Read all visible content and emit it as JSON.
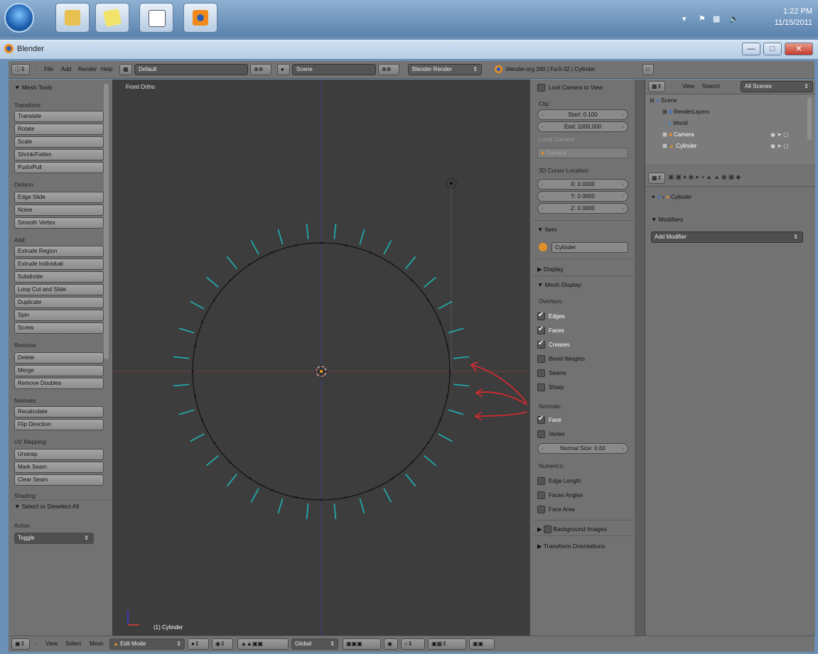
{
  "taskbar": {
    "time": "1:22 PM",
    "date": "11/15/2011",
    "buttons": [
      "start-orb",
      "file-explorer-icon",
      "sticky-notes-icon",
      "calendar-app-icon",
      "blender-app-icon"
    ]
  },
  "window": {
    "title": "Blender"
  },
  "header": {
    "menus": [
      "File",
      "Add",
      "Render",
      "Help"
    ],
    "screen_layout": "Default",
    "scene": "Scene",
    "render_engine": "Blender Render",
    "info": "blender.org 260 | Fa:0-32 | Cylinder"
  },
  "tool_shelf": {
    "title": "Mesh Tools",
    "transform_label": "Transform:",
    "transform": [
      "Translate",
      "Rotate",
      "Scale",
      "Shrink/Fatten",
      "Push/Pull"
    ],
    "deform_label": "Deform:",
    "deform": [
      "Edge Slide",
      "Noise",
      "Smooth Vertex"
    ],
    "add_label": "Add:",
    "add": [
      "Extrude Region",
      "Extrude Individual",
      "Subdivide",
      "Loop Cut and Slide",
      "Duplicate",
      "Spin",
      "Screw"
    ],
    "remove_label": "Remove:",
    "remove": [
      "Delete",
      "Merge",
      "Remove Doubles"
    ],
    "normals_label": "Normals:",
    "normals": [
      "Recalculate",
      "Flip Direction"
    ],
    "uv_label": "UV Mapping:",
    "uv": [
      "Unwrap",
      "Mark Seam",
      "Clear Seam"
    ],
    "shading_label": "Shading:",
    "operator_title": "Select or Deselect All",
    "action_label": "Action",
    "action_value": "Toggle"
  },
  "viewport": {
    "view_name": "Front Ortho",
    "object_label": "(1) Cylinder"
  },
  "properties": {
    "lock_camera": "Lock Camera to View",
    "clip_label": "Clip:",
    "clip_start": "Start: 0.100",
    "clip_end": "End: 1000.000",
    "local_camera_label": "Local Camera:",
    "local_camera": "Camera",
    "cursor_label": "3D Cursor Location:",
    "cursor_x": "X: 0.0000",
    "cursor_y": "Y: 0.0000",
    "cursor_z": "Z: 0.0000",
    "item_title": "Item",
    "item_name": "Cylinder",
    "display_title": "Display",
    "mesh_display_title": "Mesh Display",
    "overlays_label": "Overlays:",
    "overlays": [
      {
        "label": "Edges",
        "checked": true
      },
      {
        "label": "Faces",
        "checked": true
      },
      {
        "label": "Creases",
        "checked": true
      },
      {
        "label": "Bevel Weights",
        "checked": false
      },
      {
        "label": "Seams",
        "checked": false
      },
      {
        "label": "Sharp",
        "checked": false
      }
    ],
    "normals_label": "Normals:",
    "normal_face": "Face",
    "normal_vertex": "Vertex",
    "normal_size": "Normal Size: 0.60",
    "numerics_label": "Numerics:",
    "numerics": [
      "Edge Length",
      "Faces Angles",
      "Face Area"
    ],
    "background_images": "Background Images",
    "transform_orientations": "Transform Orientations"
  },
  "outliner": {
    "view": "View",
    "search": "Search",
    "filter": "All Scenes",
    "items": [
      {
        "label": "Scene"
      },
      {
        "label": "RenderLayers"
      },
      {
        "label": "World"
      },
      {
        "label": "Camera"
      },
      {
        "label": "Cylinder"
      }
    ]
  },
  "properties_editor": {
    "context_object": "Cylinder",
    "modifiers_title": "Modifiers",
    "add_modifier": "Add Modifier"
  },
  "bottom_header": {
    "view": "View",
    "select": "Select",
    "mesh": "Mesh",
    "mode": "Edit Mode",
    "orientation": "Global"
  },
  "colors": {
    "normals": "#1fb3b3",
    "annotation": "#e0282e",
    "viewport_bg": "#3d3d3d"
  }
}
